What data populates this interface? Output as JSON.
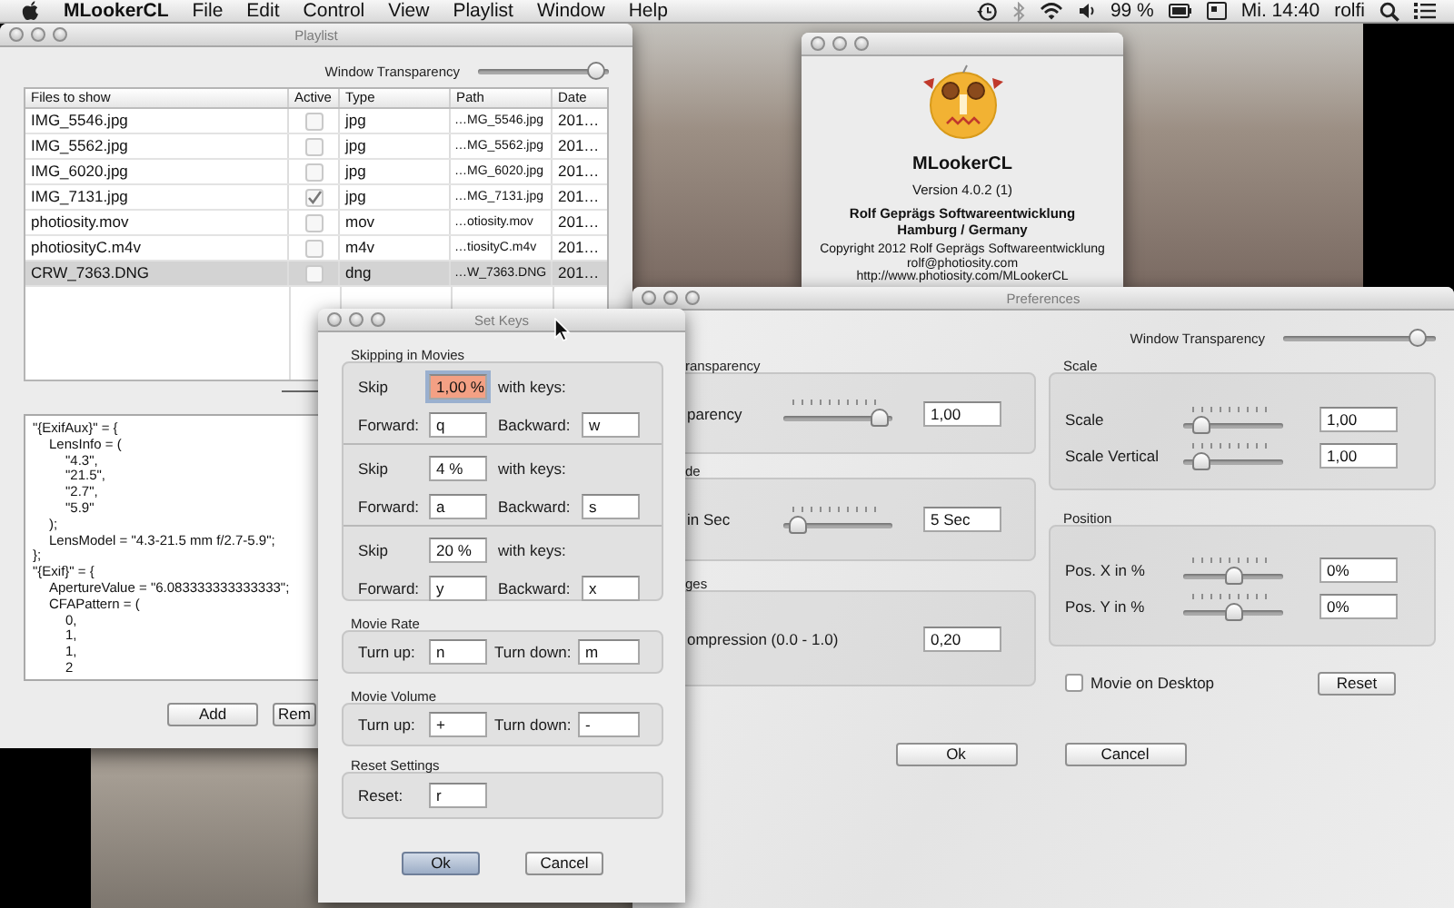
{
  "menu_bar": {
    "app_name": "MLookerCL",
    "menus": [
      "File",
      "Edit",
      "Control",
      "View",
      "Playlist",
      "Window",
      "Help"
    ],
    "battery": "99 %",
    "clock": "Mi. 14:40",
    "user": "rolfi"
  },
  "playlist_window": {
    "title": "Playlist",
    "transparency": {
      "label": "Window Transparency",
      "level": 0.97
    },
    "table": {
      "columns": [
        "Files to show",
        "Active",
        "Type",
        "Path",
        "Date"
      ],
      "rows": [
        {
          "name": "IMG_5546.jpg",
          "active": false,
          "type": "jpg",
          "path": "…MG_5546.jpg",
          "date": "201…",
          "selected": false
        },
        {
          "name": "IMG_5562.jpg",
          "active": false,
          "type": "jpg",
          "path": "…MG_5562.jpg",
          "date": "201…",
          "selected": false
        },
        {
          "name": "IMG_6020.jpg",
          "active": false,
          "type": "jpg",
          "path": "…MG_6020.jpg",
          "date": "201…",
          "selected": false
        },
        {
          "name": "IMG_7131.jpg",
          "active": true,
          "type": "jpg",
          "path": "…MG_7131.jpg",
          "date": "201…",
          "selected": false
        },
        {
          "name": "photiosity.mov",
          "active": false,
          "type": "mov",
          "path": "…otiosity.mov",
          "date": "201…",
          "selected": false
        },
        {
          "name": "photiosityC.m4v",
          "active": false,
          "type": "m4v",
          "path": "…tiosityC.m4v",
          "date": "201…",
          "selected": false
        },
        {
          "name": "CRW_7363.DNG",
          "active": false,
          "type": "dng",
          "path": "…W_7363.DNG",
          "date": "201…",
          "selected": true
        }
      ]
    },
    "metadata": [
      {
        "text": "\"{ExifAux}\" = {",
        "children": [
          {
            "text": "LensInfo = (",
            "children": [
              {
                "text": "\"4.3\","
              },
              {
                "text": "\"21.5\","
              },
              {
                "text": "\"2.7\","
              },
              {
                "text": "\"5.9\""
              }
            ]
          },
          {
            "text": ");"
          },
          {
            "text": "LensModel = \"4.3-21.5 mm f/2.7-5.9\";"
          }
        ]
      },
      {
        "text": "};"
      },
      {
        "text": "\"{Exif}\" = {",
        "children": [
          {
            "text": "ApertureValue = \"6.083333333333333\";"
          },
          {
            "text": "CFAPattern = (",
            "children": [
              {
                "text": "0,"
              },
              {
                "text": "1,"
              },
              {
                "text": "1,"
              },
              {
                "text": "2"
              }
            ]
          }
        ]
      }
    ],
    "buttons": [
      "Add",
      "Rem"
    ]
  },
  "about_window": {
    "app_name": "MLookerCL",
    "version": "Version 4.0.2 (1)",
    "company": [
      "Rolf Geprägs Softwareentwicklung",
      "Hamburg / Germany"
    ],
    "copyright": "Copyright 2012 Rolf Geprägs Softwareentwicklung",
    "email": "rolf@photiosity.com",
    "url": "http://www.photiosity.com/MLookerCL"
  },
  "preferences_window": {
    "title": "Preferences",
    "transparency": {
      "label": "Window Transparency",
      "level": 0.93
    },
    "left_groups": [
      {
        "title": "ransparency",
        "rows": [
          {
            "kind": "slider",
            "label": "parency",
            "level": 0.95,
            "value": "1,00"
          }
        ]
      },
      {
        "title": "de",
        "rows": [
          {
            "kind": "slider",
            "label": "in Sec",
            "level": 0.05,
            "value": "5 Sec"
          }
        ]
      },
      {
        "title": "ges",
        "rows": [
          {
            "kind": "field",
            "label": "ompression (0.0 - 1.0)",
            "value": "0,20"
          }
        ]
      }
    ],
    "right_groups": [
      {
        "title": "Scale",
        "rows": [
          {
            "kind": "slider",
            "label": "Scale",
            "level": 0.12,
            "value": "1,00"
          },
          {
            "kind": "slider",
            "label": "Scale Vertical",
            "level": 0.12,
            "value": "1,00"
          }
        ]
      },
      {
        "title": "Position",
        "rows": [
          {
            "kind": "slider",
            "label": "Pos. X in %",
            "level": 0.5,
            "value": "0%"
          },
          {
            "kind": "slider",
            "label": "Pos. Y in %",
            "level": 0.5,
            "value": "0%"
          }
        ]
      }
    ],
    "movie_on_desktop": {
      "label": "Movie on Desktop",
      "checked": false
    },
    "reset_button": "Reset",
    "buttons": [
      "Ok",
      "Cancel"
    ]
  },
  "set_keys_window": {
    "title": "Set Keys",
    "skipping": {
      "title": "Skipping in Movies",
      "steps": [
        {
          "skip_label": "Skip",
          "amount": "1,00 %",
          "highlighted": true,
          "keys_label": "with keys:",
          "forward_label": "Forward:",
          "forward": "q",
          "backward_label": "Backward:",
          "backward": "w"
        },
        {
          "skip_label": "Skip",
          "amount": "4 %",
          "highlighted": false,
          "keys_label": "with keys:",
          "forward_label": "Forward:",
          "forward": "a",
          "backward_label": "Backward:",
          "backward": "s"
        },
        {
          "skip_label": "Skip",
          "amount": "20 %",
          "highlighted": false,
          "keys_label": "with keys:",
          "forward_label": "Forward:",
          "forward": "y",
          "backward_label": "Backward:",
          "backward": "x"
        }
      ]
    },
    "movie_rate": {
      "title": "Movie Rate",
      "up_label": "Turn up:",
      "up": "n",
      "down_label": "Turn down:",
      "down": "m"
    },
    "movie_volume": {
      "title": "Movie Volume",
      "up_label": "Turn up:",
      "up": "+",
      "down_label": "Turn down:",
      "down": "-"
    },
    "reset": {
      "title": "Reset Settings",
      "label": "Reset:",
      "value": "r"
    },
    "buttons": [
      {
        "label": "Ok",
        "default": true
      },
      {
        "label": "Cancel",
        "default": false
      }
    ]
  }
}
